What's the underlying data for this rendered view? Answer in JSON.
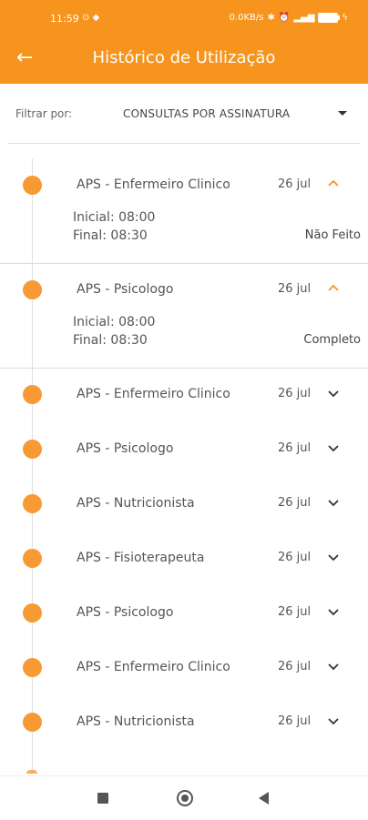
{
  "status_bar": {
    "time": "11:59",
    "time_icons": "⊙ ◆",
    "network_speed": "0.0KB/s",
    "battery_level": "100"
  },
  "app_bar": {
    "title": "Histórico de Utilização",
    "back_icon": "arrow-left"
  },
  "filter": {
    "label": "Filtrar por:",
    "value": "CONSULTAS POR ASSINATURA"
  },
  "colors": {
    "accent": "#f7941d",
    "dot": "#f79a33"
  },
  "items": [
    {
      "name": "APS - Enfermeiro Clinico",
      "date": "26 jul",
      "expanded": true,
      "start": "Inicial: 08:00",
      "end": "Final: 08:30",
      "status": "Não Feito"
    },
    {
      "name": "APS - Psicologo",
      "date": "26 jul",
      "expanded": true,
      "start": "Inicial: 08:00",
      "end": "Final: 08:30",
      "status": "Completo"
    },
    {
      "name": "APS - Enfermeiro Clinico",
      "date": "26 jul",
      "expanded": false
    },
    {
      "name": "APS - Psicologo",
      "date": "26 jul",
      "expanded": false
    },
    {
      "name": "APS - Nutricionista",
      "date": "26 jul",
      "expanded": false
    },
    {
      "name": "APS - Fisioterapeuta",
      "date": "26 jul",
      "expanded": false
    },
    {
      "name": "APS - Psicologo",
      "date": "26 jul",
      "expanded": false
    },
    {
      "name": "APS - Enfermeiro Clinico",
      "date": "26 jul",
      "expanded": false
    },
    {
      "name": "APS - Nutricionista",
      "date": "26 jul",
      "expanded": false
    }
  ]
}
